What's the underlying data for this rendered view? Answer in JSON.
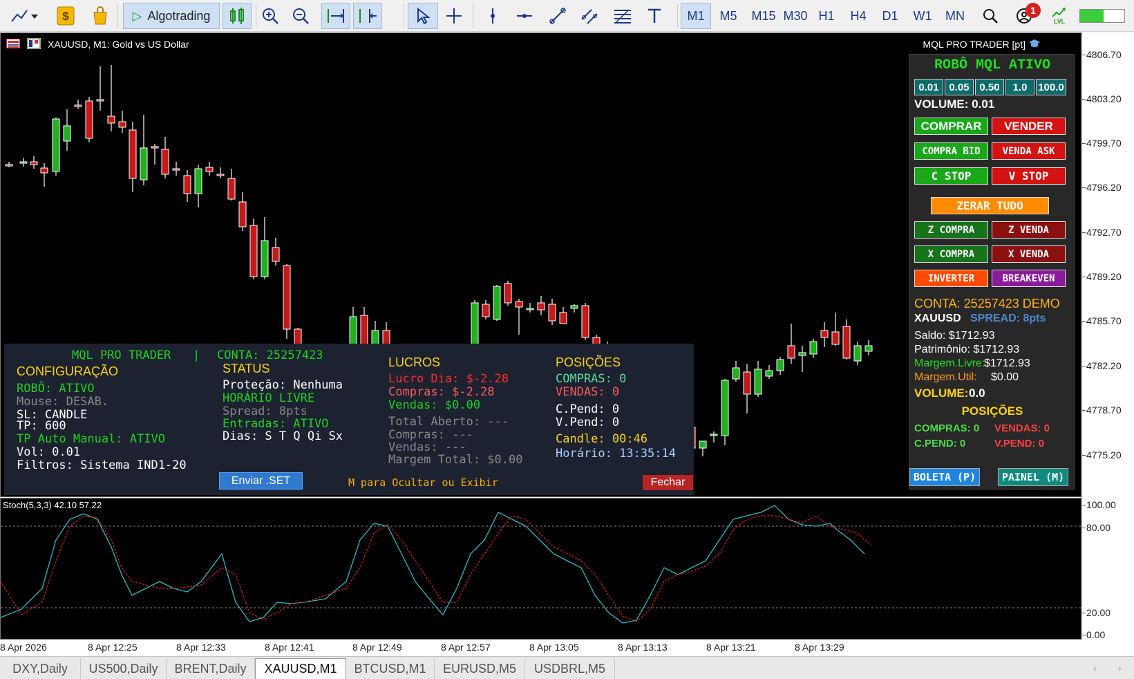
{
  "toolbar": {
    "algotrading_label": "Algotrading",
    "timeframes": [
      "M1",
      "M5",
      "M15",
      "M30",
      "H1",
      "H4",
      "D1",
      "W1",
      "MN"
    ],
    "active_timeframe": "M1",
    "notification_count": "1",
    "lvl_label": "LVL"
  },
  "chart": {
    "title": "XAUUSD, M1:  Gold vs US Dollar",
    "brand": "MQL PRO TRADER [pt]",
    "price_labels": [
      "4806.70",
      "4803.20",
      "4799.70",
      "4796.20",
      "4792.70",
      "4789.20",
      "4785.70",
      "4782.20",
      "4778.70",
      "4775.20"
    ],
    "sub_labels": [
      "100.00",
      "80.00",
      "20.00",
      "0.00"
    ],
    "time_labels": [
      "8 Apr 2026",
      "8 Apr 12:25",
      "8 Apr 12:33",
      "8 Apr 12:41",
      "8 Apr 12:49",
      "8 Apr 12:57",
      "8 Apr 13:05",
      "8 Apr 13:13",
      "8 Apr 13:21",
      "8 Apr 13:29"
    ],
    "indicator_label": "Stoch(5,3,3) 42.10 57.22"
  },
  "robot_panel": {
    "title": "ROBÔ MQL ATIVO",
    "volume_buttons": [
      "0.01",
      "0.05",
      "0.50",
      "1.0",
      "100.0"
    ],
    "volume_label": "VOLUME: 0.01",
    "buy": "COMPRAR",
    "sell": "VENDER",
    "buy_bid": "COMPRA BID",
    "sell_ask": "VENDA ASK",
    "buy_stop": "C STOP",
    "sell_stop": "V STOP",
    "close_all": "ZERAR TUDO",
    "close_buy": "Z COMPRA",
    "close_sell": "Z VENDA",
    "x_buy": "X COMPRA",
    "x_sell": "X VENDA",
    "invert": "INVERTER",
    "breakeven": "BREAKEVEN",
    "account": "CONTA: 25257423 DEMO",
    "symbol": "XAUUSD",
    "spread": "SPREAD: 8pts",
    "saldo": "Saldo: $1712.93",
    "patrimonio": "Patrimônio: $1712.93",
    "margem_livre_label": "Margem.Livre:",
    "margem_livre_value": "$1712.93",
    "margem_util_label": "Margem.Util:",
    "margem_util_value": "$0.00",
    "volume_label2": "VOLUME:",
    "volume_value2": "0.0",
    "posicoes": "POSIÇÕES",
    "compras": "COMPRAS: 0",
    "vendas": "VENDAS: 0",
    "cpend": "C.PEND: 0",
    "vpend": "V.PEND: 0",
    "boleta": "BOLETA (P)",
    "painel": "PAINEL (M)"
  },
  "info_panel": {
    "header_left": "MQL PRO TRADER",
    "header_sep": "|",
    "header_right": "CONTA: 25257423",
    "config_title": "CONFIGURAÇÃO",
    "robo": "ROBÔ: ATIVO",
    "mouse": "Mouse: DESAB.",
    "sl": "SL: CANDLE",
    "tp": "TP: 600",
    "tp_auto": "TP Auto Manual: ATIVO",
    "vol": "Vol: 0.01",
    "filtros": "Filtros: Sistema IND1-20",
    "status_title": "STATUS",
    "protecao": "Proteção: Nenhuma",
    "horario_livre": "HORÁRIO LIVRE",
    "spread": "Spread: 8pts",
    "entradas": "Entradas: ATIVO",
    "dias": "Dias: S T Q Qi Sx",
    "lucros_title": "LUCROS",
    "lucro_dia": "Lucro Dia: $-2.28",
    "compras": "Compras: $-2.28",
    "vendas": "Vendas: $0.00",
    "total_aberto": "Total Aberto: ---",
    "compras2": "Compras: ---",
    "vendas2": "Vendas: ---",
    "margem_total": "Margem Total: $0.00",
    "posicoes_title": "POSIÇÕES",
    "pos_compras": "COMPRAS: 0",
    "pos_vendas": "VENDAS: 0",
    "cpend": "C.Pend: 0",
    "vpend": "V.Pend: 0",
    "candle": "Candle: 00:46",
    "horario": "Horário: 13:35:14",
    "enviar": "Enviar .SET",
    "hint": "M para Ocultar ou Exibir",
    "fechar": "Fechar"
  },
  "tabs": [
    "DXY,Daily",
    "US500,Daily",
    "BRENT,Daily",
    "XAUUSD,M1",
    "BTCUSD,M1",
    "EURUSD,M5",
    "USDBRL,M5"
  ],
  "active_tab": "XAUUSD,M1"
}
